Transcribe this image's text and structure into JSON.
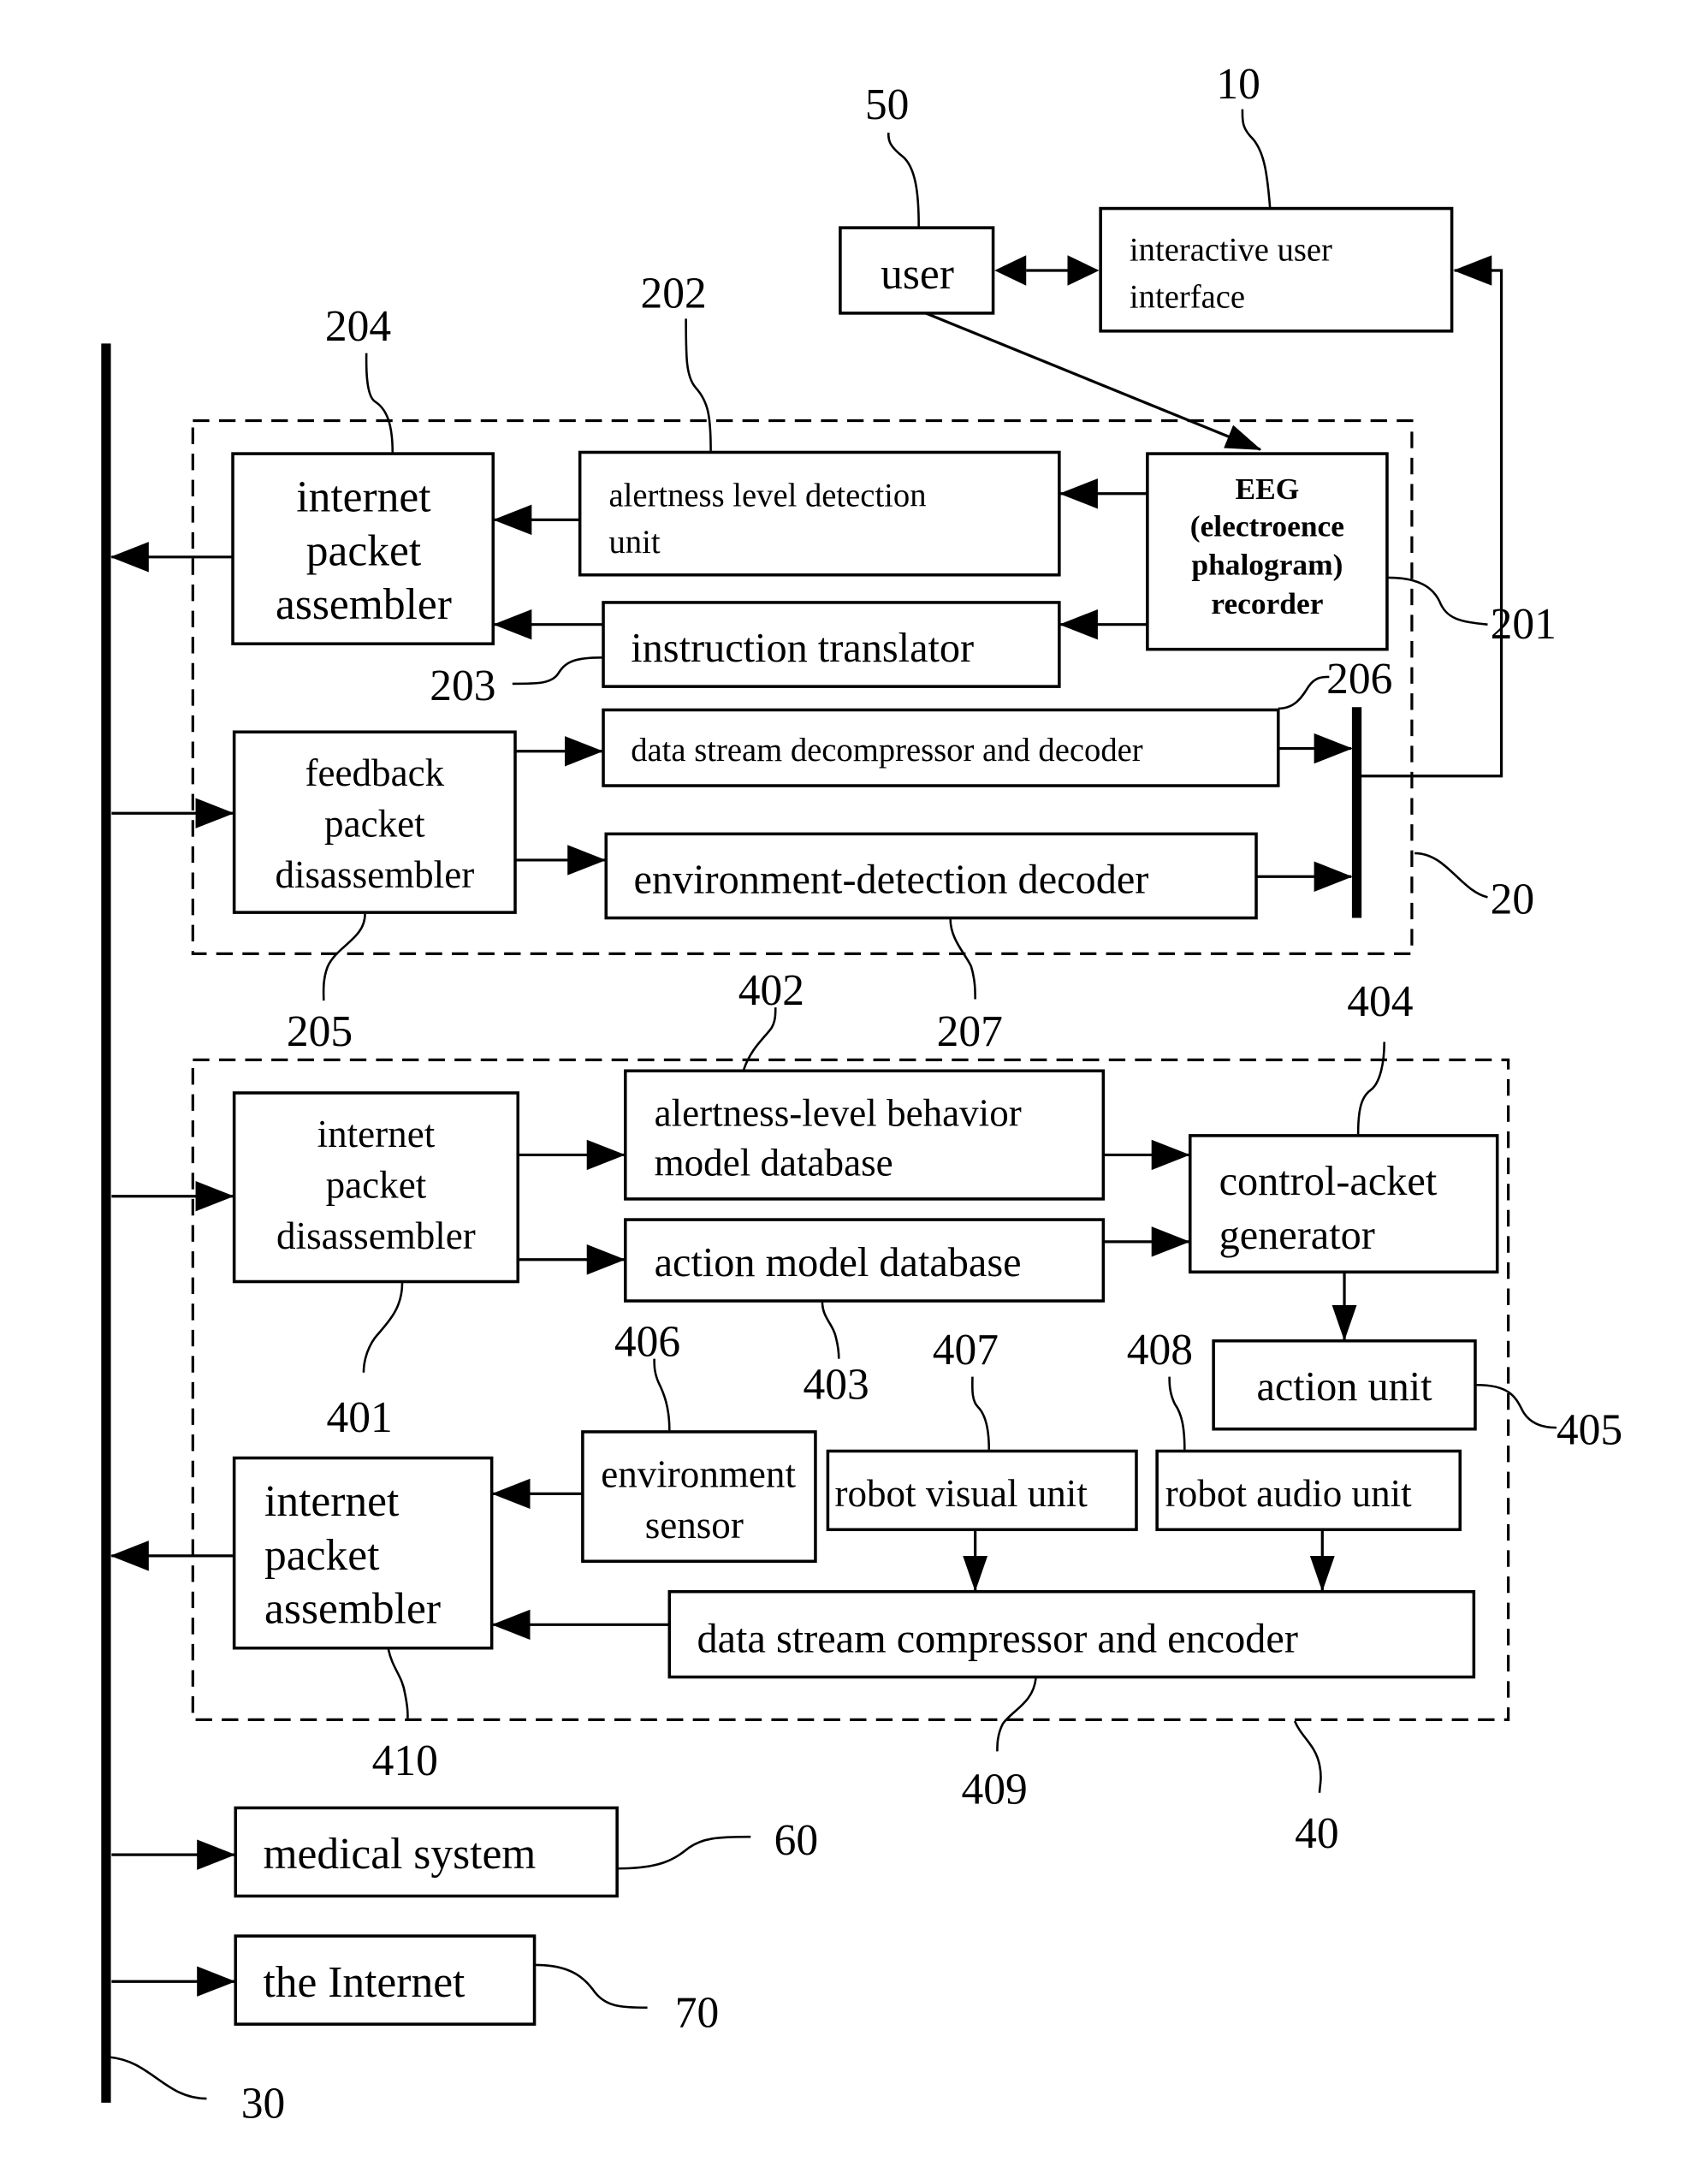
{
  "diagram": {
    "type": "block-diagram",
    "colors": {
      "ink": "#000000",
      "background": "#ffffff"
    },
    "external": {
      "user": {
        "label": "user",
        "ref": "50"
      },
      "interactive_ui": {
        "lines": [
          "interactive user",
          "interface"
        ],
        "ref": "10"
      },
      "medical": {
        "label": "medical system",
        "ref": "60"
      },
      "internet": {
        "label": "the Internet",
        "ref": "70"
      },
      "bus": {
        "ref": "30"
      }
    },
    "block20": {
      "ref": "20",
      "eeg": {
        "lines": [
          "EEG",
          "(electroence",
          "phalogram)",
          "recorder"
        ],
        "ref": "201"
      },
      "alertness": {
        "lines": [
          "alertness level detection",
          "unit"
        ],
        "ref": "202"
      },
      "translator": {
        "label": "instruction translator",
        "ref": "203"
      },
      "assembler": {
        "lines": [
          "internet",
          "packet",
          "assembler"
        ],
        "ref": "204"
      },
      "feedback": {
        "lines": [
          "feedback",
          "packet",
          "disassembler"
        ],
        "ref": "205"
      },
      "decompressor": {
        "label": "data stream decompressor and decoder",
        "ref": "206"
      },
      "envdecoder": {
        "label": "environment-detection decoder",
        "ref": "207"
      }
    },
    "block40": {
      "ref": "40",
      "disassembler": {
        "lines": [
          "internet",
          "packet",
          "disassembler"
        ],
        "ref": "401"
      },
      "behavior_db": {
        "lines": [
          "alertness-level behavior",
          "model database"
        ],
        "ref": "402"
      },
      "action_db": {
        "label": "action model database",
        "ref": "403"
      },
      "control": {
        "lines": [
          "control-acket",
          "generator"
        ],
        "ref": "404"
      },
      "action_unit": {
        "label": "action unit",
        "ref": "405"
      },
      "env_sensor": {
        "lines": [
          "environment",
          "sensor"
        ],
        "ref": "406"
      },
      "visual": {
        "label": "robot visual unit",
        "ref": "407"
      },
      "audio": {
        "label": "robot audio unit",
        "ref": "408"
      },
      "compressor": {
        "label": "data stream compressor and encoder",
        "ref": "409"
      },
      "assembler": {
        "lines": [
          "internet",
          "packet",
          "assembler"
        ],
        "ref": "410"
      }
    }
  }
}
